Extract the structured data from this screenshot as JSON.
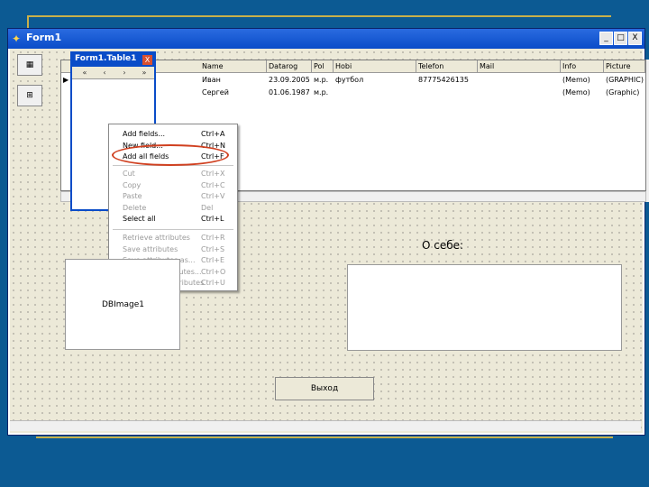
{
  "window": {
    "title": "Form1",
    "minimize": "_",
    "maximize": "□",
    "close": "X"
  },
  "grid": {
    "columns": [
      "Name",
      "Datarog",
      "Pol",
      "Hobi",
      "Telefon",
      "Mail",
      "Info",
      "Picture"
    ],
    "rows": [
      [
        "Иван",
        "23.09.2005",
        "м.р.",
        "футбол",
        "87775426135",
        "",
        "(Memo)",
        "(GRAPHIC)"
      ],
      [
        "Сергей",
        "01.06.1987",
        "м.р.",
        "",
        "",
        "",
        "(Memo)",
        "(Graphic)"
      ]
    ]
  },
  "sub_window": {
    "title": "Form1.Table1",
    "close": "X",
    "nav": [
      "«",
      "‹",
      "›",
      "»"
    ]
  },
  "context_menu": {
    "items": [
      {
        "label": "Add fields...",
        "shortcut": "Ctrl+A",
        "enabled": true
      },
      {
        "label": "New field...",
        "shortcut": "Ctrl+N",
        "enabled": true
      },
      {
        "label": "Add all fields",
        "shortcut": "Ctrl+F",
        "enabled": true
      },
      {
        "label": "Cut",
        "shortcut": "Ctrl+X",
        "enabled": false
      },
      {
        "label": "Copy",
        "shortcut": "Ctrl+C",
        "enabled": false
      },
      {
        "label": "Paste",
        "shortcut": "Ctrl+V",
        "enabled": false
      },
      {
        "label": "Delete",
        "shortcut": "Del",
        "enabled": false
      },
      {
        "label": "Select all",
        "shortcut": "Ctrl+L",
        "enabled": true
      },
      {
        "label": "Retrieve attributes",
        "shortcut": "Ctrl+R",
        "enabled": false
      },
      {
        "label": "Save attributes",
        "shortcut": "Ctrl+S",
        "enabled": false
      },
      {
        "label": "Save attributes as...",
        "shortcut": "Ctrl+E",
        "enabled": false
      },
      {
        "label": "Associate attributes...",
        "shortcut": "Ctrl+O",
        "enabled": false
      },
      {
        "label": "Unassociate attributes",
        "shortcut": "Ctrl+U",
        "enabled": false
      }
    ]
  },
  "image_label": "DBImage1",
  "about_label": "О себе:",
  "exit_button": "Выход",
  "colors": {
    "slide_bg": "#0c5a93",
    "highlight": "#d04020",
    "titlebar": "#0a4cc8"
  }
}
